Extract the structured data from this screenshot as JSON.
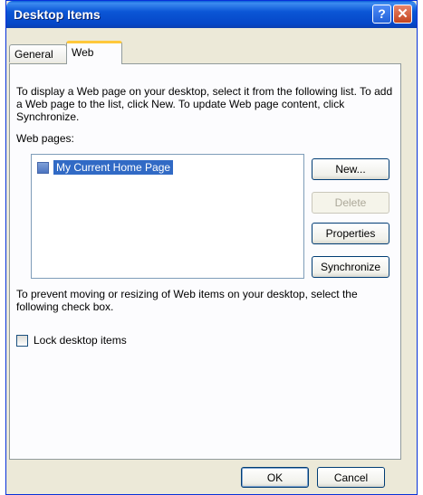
{
  "window": {
    "title": "Desktop Items",
    "help_glyph": "?",
    "close_glyph": "✕"
  },
  "tabs": [
    {
      "label": "General",
      "active": false
    },
    {
      "label": "Web",
      "active": true
    }
  ],
  "web_tab": {
    "intro_text": "To display a Web page on your desktop, select it from the following list. To add a Web page to the list, click New.  To update Web page content, click Synchronize.",
    "list_label": "Web pages:",
    "list_items": [
      {
        "label": "My Current Home Page",
        "checked": false,
        "selected": true
      }
    ],
    "buttons": {
      "new": "New...",
      "delete": "Delete",
      "properties": "Properties",
      "synchronize": "Synchronize"
    },
    "lock_hint": "To prevent moving or resizing of Web items on your desktop, select the following check box.",
    "lock_label": "Lock desktop items",
    "lock_checked": false
  },
  "footer": {
    "ok": "OK",
    "cancel": "Cancel"
  },
  "colors": {
    "titlebar": "#0b56d6",
    "selection": "#316ac5",
    "active_tab_accent": "#ffc83c"
  }
}
